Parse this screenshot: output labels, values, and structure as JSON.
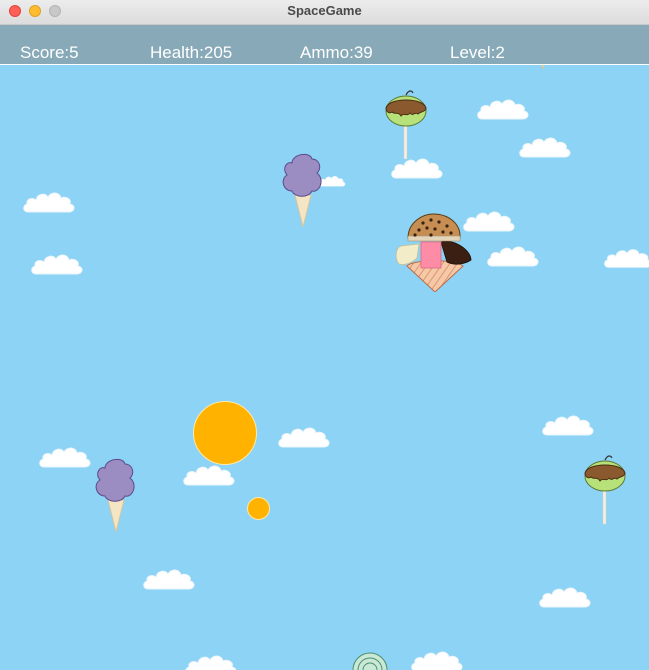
{
  "window": {
    "title": "SpaceGame"
  },
  "hud": {
    "score": "Score:5",
    "health": "Health:205",
    "ammo": "Ammo:39",
    "level": "Level:2"
  },
  "colors": {
    "sky": "#8cd3f5",
    "hud_bar": "#87a9b8",
    "projectile": "#ffb300",
    "cotton_candy": "#9b8dc2",
    "candy_apple_top": "#8a5a2e",
    "candy_apple_bottom": "#b7e27a"
  },
  "sprites": {
    "player": "ice-cream-cone-with-cookie-icon",
    "enemy_a": "cotton-candy-icon",
    "enemy_b": "candy-apple-icon",
    "projectile": "orange-ball-icon"
  }
}
